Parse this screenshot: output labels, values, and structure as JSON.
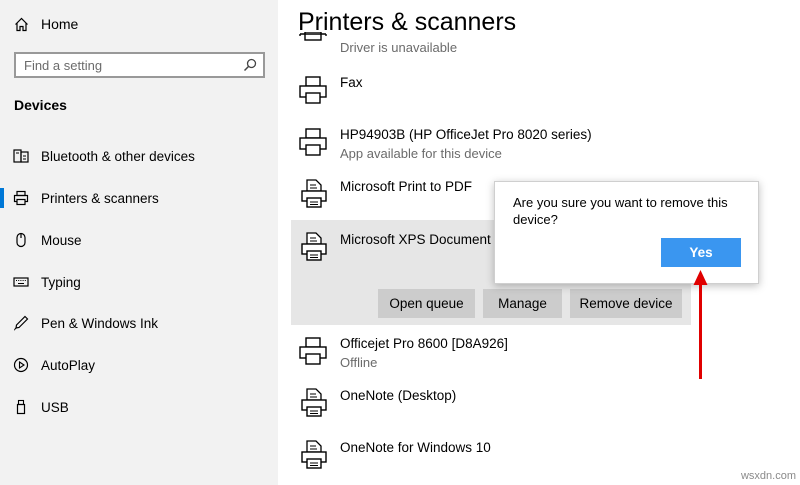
{
  "sidebar": {
    "home_label": "Home",
    "search_placeholder": "Find a setting",
    "section_title": "Devices",
    "items": [
      {
        "label": "Bluetooth & other devices",
        "icon": "bluetooth-devices-icon"
      },
      {
        "label": "Printers & scanners",
        "icon": "printer-icon",
        "selected": true
      },
      {
        "label": "Mouse",
        "icon": "mouse-icon"
      },
      {
        "label": "Typing",
        "icon": "keyboard-icon"
      },
      {
        "label": "Pen & Windows Ink",
        "icon": "pen-icon"
      },
      {
        "label": "AutoPlay",
        "icon": "autoplay-icon"
      },
      {
        "label": "USB",
        "icon": "usb-icon"
      }
    ]
  },
  "main": {
    "title": "Printers & scanners",
    "devices": [
      {
        "name": "",
        "status": "Driver is unavailable",
        "icon": "printer-icon"
      },
      {
        "name": "Fax",
        "status": "",
        "icon": "printer-icon"
      },
      {
        "name": "HP94903B (HP OfficeJet Pro 8020 series)",
        "status": "App available for this device",
        "icon": "printer-icon"
      },
      {
        "name": "Microsoft Print to PDF",
        "status": "",
        "icon": "document-printer-icon"
      },
      {
        "name": "Microsoft XPS Document W",
        "status": "",
        "icon": "document-printer-icon"
      },
      {
        "name": "Officejet Pro 8600 [D8A926]",
        "status": "Offline",
        "icon": "printer-icon"
      },
      {
        "name": "OneNote (Desktop)",
        "status": "",
        "icon": "document-printer-icon"
      },
      {
        "name": "OneNote for Windows 10",
        "status": "",
        "icon": "document-printer-icon"
      }
    ],
    "actions": {
      "open_queue": "Open queue",
      "manage": "Manage",
      "remove_device": "Remove device"
    }
  },
  "dialog": {
    "message": "Are you sure you want to remove this device?",
    "confirm_label": "Yes"
  },
  "watermark": "wsxdn.com",
  "colors": {
    "accent": "#0078d7",
    "confirm_button": "#3a96f0",
    "annotation_arrow": "#e00000",
    "sidebar_bg": "#f2f2f2",
    "selected_row_bg": "#e6e6e6"
  }
}
